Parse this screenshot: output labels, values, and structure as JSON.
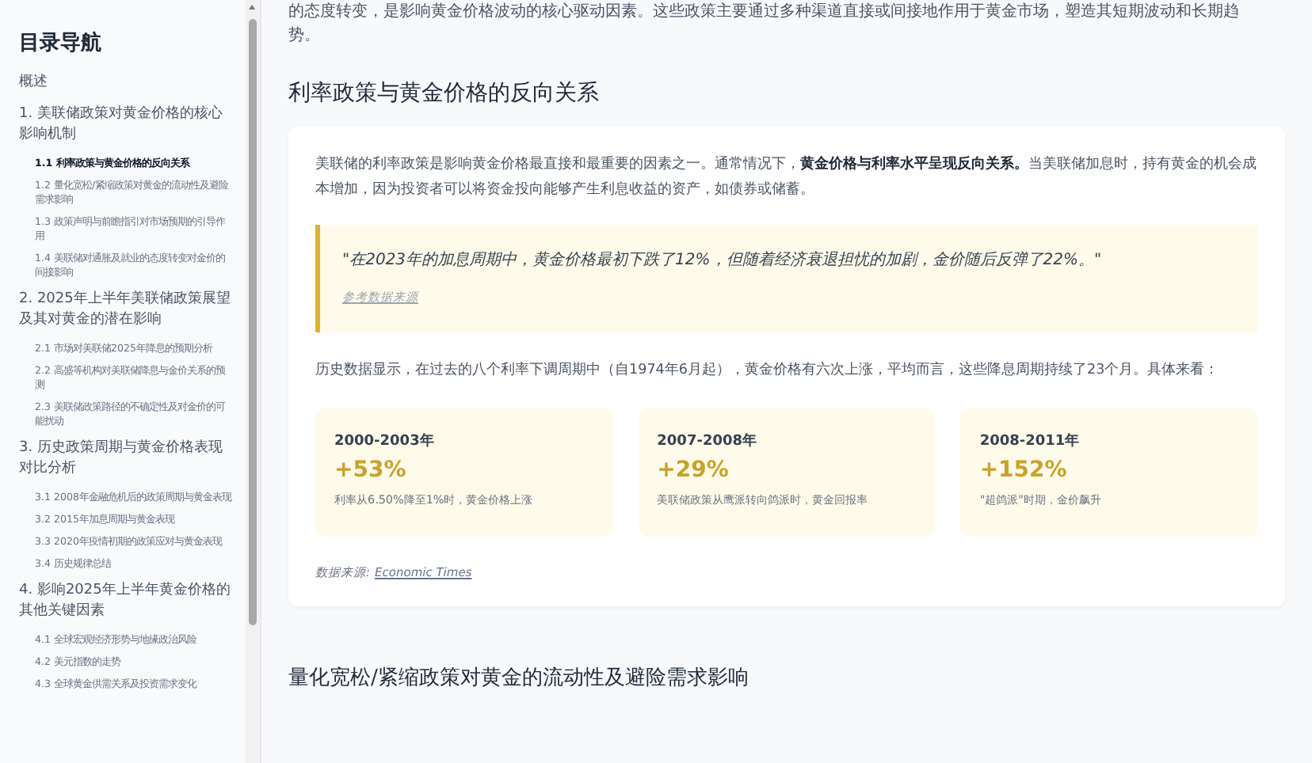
{
  "sidebar": {
    "title": "目录导航",
    "items": [
      {
        "label": "概述",
        "selected": false
      },
      {
        "label": "1. 美联储政策对黄金价格的核心影响机制",
        "selected": false,
        "children": [
          {
            "label": "1.1 利率政策与黄金价格的反向关系",
            "selected": true
          },
          {
            "label": "1.2 量化宽松/紧缩政策对黄金的流动性及避险需求影响",
            "selected": false
          },
          {
            "label": "1.3 政策声明与前瞻指引对市场预期的引导作用",
            "selected": false
          },
          {
            "label": "1.4 美联储对通胀及就业的态度转变对金价的间接影响",
            "selected": false
          }
        ]
      },
      {
        "label": "2. 2025年上半年美联储政策展望及其对黄金的潜在影响",
        "selected": false,
        "children": [
          {
            "label": "2.1 市场对美联储2025年降息的预期分析",
            "selected": false
          },
          {
            "label": "2.2 高盛等机构对美联储降息与金价关系的预测",
            "selected": false
          },
          {
            "label": "2.3 美联储政策路径的不确定性及对金价的可能扰动",
            "selected": false
          }
        ]
      },
      {
        "label": "3. 历史政策周期与黄金价格表现对比分析",
        "selected": false,
        "children": [
          {
            "label": "3.1 2008年金融危机后的政策周期与黄金表现",
            "selected": false
          },
          {
            "label": "3.2 2015年加息周期与黄金表现",
            "selected": false
          },
          {
            "label": "3.3 2020年疫情初期的政策应对与黄金表现",
            "selected": false
          },
          {
            "label": "3.4 历史规律总结",
            "selected": false
          }
        ]
      },
      {
        "label": "4. 影响2025年上半年黄金价格的其他关键因素",
        "selected": false,
        "children": [
          {
            "label": "4.1 全球宏观经济形势与地缘政治风险",
            "selected": false
          },
          {
            "label": "4.2 美元指数的走势",
            "selected": false
          },
          {
            "label": "4.3 全球黄金供需关系及投资需求变化",
            "selected": false
          }
        ]
      }
    ]
  },
  "article": {
    "intro": "的态度转变，是影响黄金价格波动的核心驱动因素。这些政策主要通过多种渠道直接或间接地作用于黄金市场，塑造其短期波动和长期趋势。",
    "section_title": "利率政策与黄金价格的反向关系",
    "card": {
      "paragraph": "美联储的利率政策是影响黄金价格最直接和最重要的因素之一。通常情况下，**黄金价格与利率水平呈现反向关系。**当美联储加息时，持有黄金的机会成本增加，因为投资者可以将资金投向能够产生利息收益的资产，如债券或储蓄。",
      "quote": "\"在2023年的加息周期中，黄金价格最初下跌了12%，但随着经济衰退担忧的加剧，金价随后反弹了22%。\"",
      "quote_source": "参考数据来源",
      "paragraph_2": "历史数据显示，在过去的八个利率下调周期中（自1974年6月起），黄金价格有六次上涨，平均而言，这些降息周期持续了23个月。具体来看：",
      "stats": [
        {
          "period": "2000-2003年",
          "change": "+53%",
          "note": "利率从6.50%降至1%时，黄金价格上涨"
        },
        {
          "period": "2007-2008年",
          "change": "+29%",
          "note": "美联储政策从鹰派转向鸽派时，黄金回报率"
        },
        {
          "period": "2008-2011年",
          "change": "+152%",
          "note": "\"超鸽派\"时期，金价飙升"
        }
      ],
      "source_label": "数据来源:",
      "source_link": "Economic Times"
    },
    "next_section_title": "量化宽松/紧缩政策对黄金的流动性及避险需求影响"
  }
}
